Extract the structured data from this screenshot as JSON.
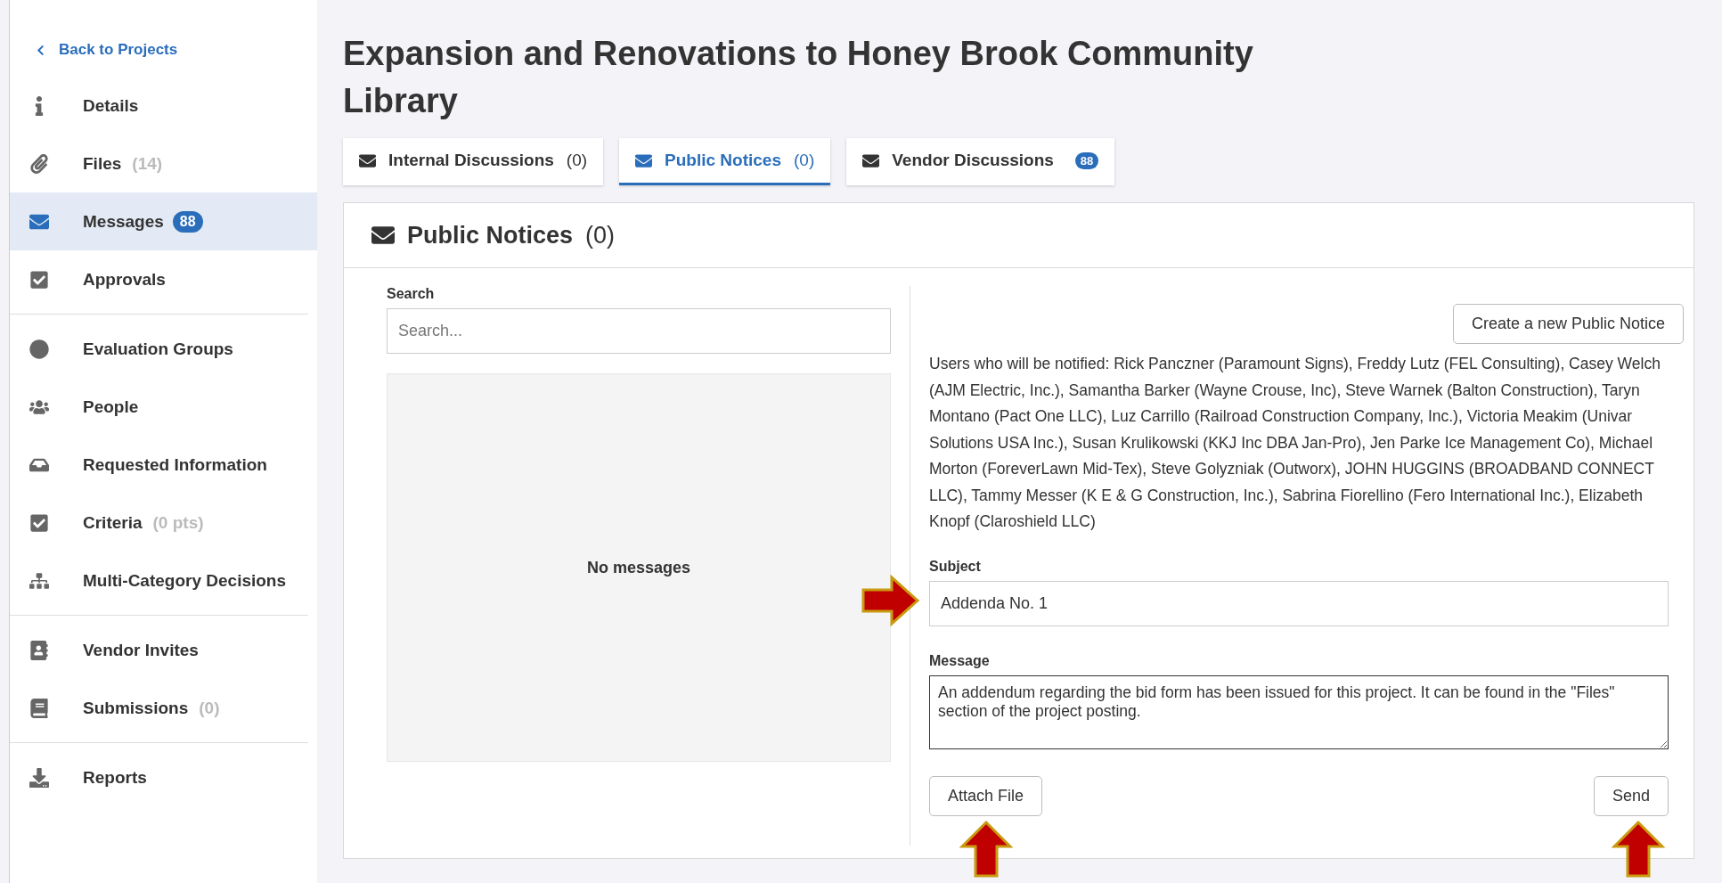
{
  "sidebar": {
    "back_link": "Back to Projects",
    "groups": [
      [
        {
          "label": "Details",
          "selected": false
        },
        {
          "label": "Files",
          "count": "(14)",
          "selected": false
        },
        {
          "label": "Messages",
          "badge": "88",
          "selected": true
        },
        {
          "label": "Approvals",
          "selected": false
        }
      ],
      [
        {
          "label": "Evaluation Groups",
          "selected": false
        },
        {
          "label": "People",
          "selected": false
        },
        {
          "label": "Requested Information",
          "selected": false
        },
        {
          "label": "Criteria",
          "count": "(0 pts)",
          "selected": false
        },
        {
          "label": "Multi-Category Decisions",
          "selected": false
        }
      ],
      [
        {
          "label": "Vendor Invites",
          "selected": false
        },
        {
          "label": "Submissions",
          "count": "(0)",
          "selected": false
        }
      ],
      [
        {
          "label": "Reports",
          "selected": false
        }
      ]
    ]
  },
  "page_title": "Expansion and Renovations to Honey Brook Community Library",
  "tabs": [
    {
      "label": "Internal Discussions",
      "count": "(0)",
      "selected": false
    },
    {
      "label": "Public Notices",
      "count": "(0)",
      "selected": true
    },
    {
      "label": "Vendor Discussions",
      "badge": "88",
      "selected": false
    }
  ],
  "panel": {
    "title": "Public Notices",
    "count": "(0)",
    "search": {
      "label": "Search",
      "placeholder": "Search..."
    },
    "empty_message": "No messages",
    "create_button": "Create a new Public Notice",
    "notified_text": "Users who will be notified: Rick Panczner (Paramount Signs), Freddy Lutz (FEL Consulting), Casey Welch (AJM Electric, Inc.), Samantha Barker (Wayne Crouse, Inc), Steve Warnek (Balton Construction), Taryn Montano (Pact One LLC), Luz Carrillo (Railroad Construction Company, Inc.), Victoria Meakim (Univar Solutions USA Inc.), Susan Krulikowski (KKJ Inc DBA Jan-Pro), Jen Parke Ice Management Co), Michael Morton (ForeverLawn Mid-Tex), Steve Golyzniak (Outworx), JOHN HUGGINS (BROADBAND CONNECT LLC), Tammy Messer (K E & G Construction, Inc.), Sabrina Fiorellino (Fero International Inc.), Elizabeth Knopf (Claroshield LLC)",
    "subject": {
      "label": "Subject",
      "value": "Addenda No. 1"
    },
    "message": {
      "label": "Message",
      "value": "An addendum regarding the bid form has been issued for this project. It can be found in the \"Files\" section of the project posting."
    },
    "attach_button": "Attach File",
    "send_button": "Send"
  }
}
